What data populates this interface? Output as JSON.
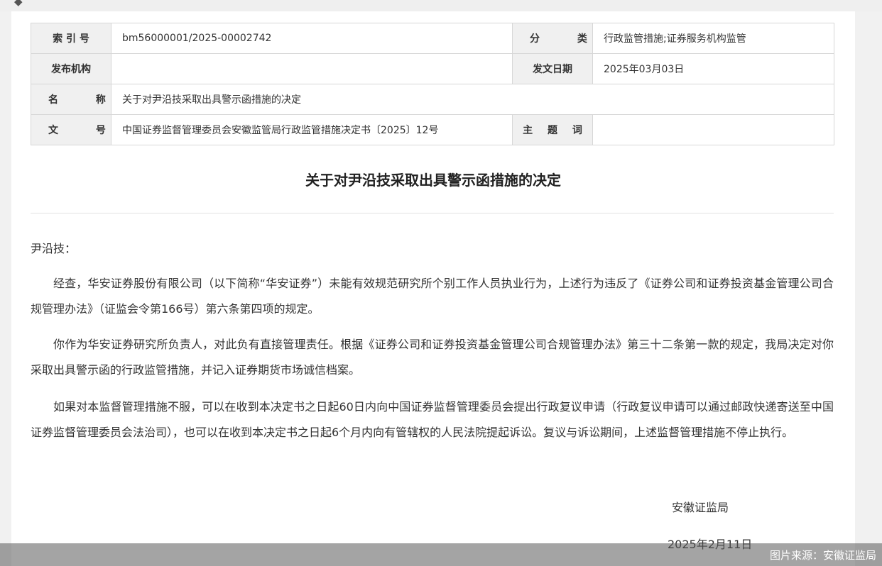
{
  "meta": {
    "index_label": "索 引 号",
    "index_value": "bm56000001/2025-00002742",
    "category_label": "分 类",
    "category_value": "行政监管措施;证券服务机构监管",
    "publisher_label": "发布机构",
    "publisher_value": "",
    "issue_date_label": "发文日期",
    "issue_date_value": "2025年03月03日",
    "name_label": "名 称",
    "name_value": "关于对尹沿技采取出具警示函措施的决定",
    "doc_no_label": "文 号",
    "doc_no_value": "中国证券监督管理委员会安徽监管局行政监管措施决定书〔2025〕12号",
    "subject_label": "主 题 词",
    "subject_value": ""
  },
  "document": {
    "title": "关于对尹沿技采取出具警示函措施的决定",
    "salutation": "尹沿技：",
    "paragraphs": [
      "经查，华安证券股份有限公司（以下简称“华安证券”）未能有效规范研究所个别工作人员执业行为，上述行为违反了《证券公司和证券投资基金管理公司合规管理办法》（证监会令第166号）第六条第四项的规定。",
      "你作为华安证券研究所负责人，对此负有直接管理责任。根据《证券公司和证券投资基金管理公司合规管理办法》第三十二条第一款的规定，我局决定对你采取出具警示函的行政监管措施，并记入证券期货市场诚信档案。",
      "如果对本监督管理措施不服，可以在收到本决定书之日起60日内向中国证券监督管理委员会提出行政复议申请（行政复议申请可以通过邮政快递寄送至中国证券监督管理委员会法治司），也可以在收到本决定书之日起6个月内向有管辖权的人民法院提起诉讼。复议与诉讼期间，上述监督管理措施不停止执行。"
    ],
    "issuer": "安徽证监局",
    "date": "2025年2月11日"
  },
  "overlay": {
    "credit": "图片来源：安徽证监局"
  }
}
